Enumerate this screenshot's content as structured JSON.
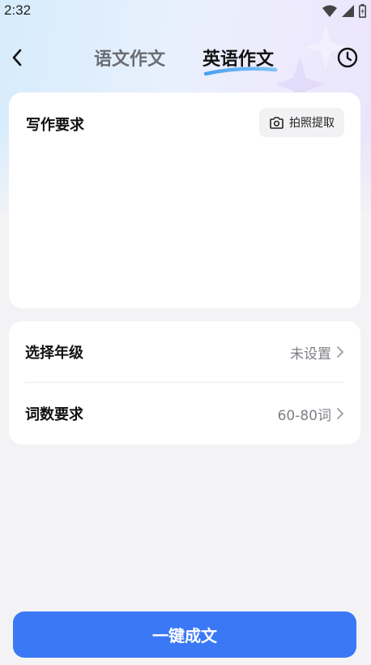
{
  "status_bar": {
    "time": "2:32"
  },
  "header": {
    "tabs": [
      {
        "label": "语文作文",
        "active": false
      },
      {
        "label": "英语作文",
        "active": true
      }
    ]
  },
  "requirements": {
    "title": "写作要求",
    "photo_button_label": "拍照提取",
    "input_value": "",
    "input_placeholder": ""
  },
  "settings": {
    "grade": {
      "label": "选择年级",
      "value": "未设置"
    },
    "word_count": {
      "label": "词数要求",
      "value": "60-80词"
    }
  },
  "actions": {
    "generate_label": "一键成文"
  },
  "colors": {
    "accent": "#3b78f6",
    "tab_underline": "#5aa8f0",
    "background": "#f3f3f5"
  },
  "icons": [
    "back-arrow",
    "history-clock",
    "camera",
    "chevron-right",
    "wifi",
    "signal",
    "battery"
  ]
}
